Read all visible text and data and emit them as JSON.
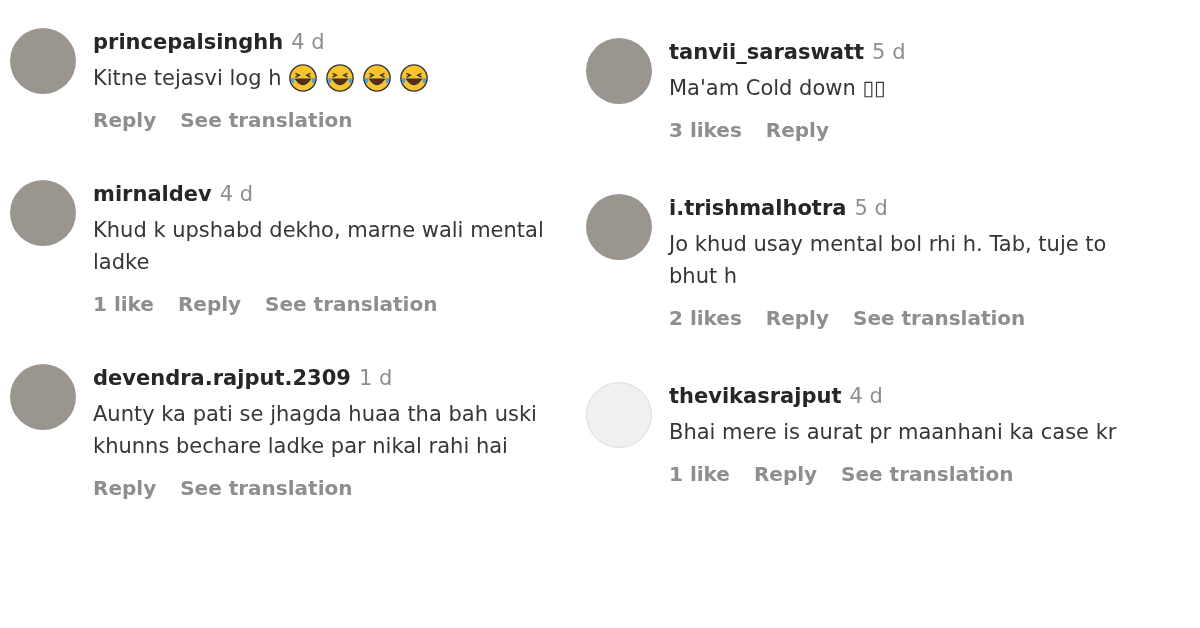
{
  "columns": [
    {
      "comments": [
        {
          "username": "princepalsinghh",
          "time": "4 d",
          "text": "Kitne tejasvi log h",
          "emojis": [
            {
              "kind": "laughing"
            },
            {
              "kind": "laughing"
            },
            {
              "kind": "laughing"
            },
            {
              "kind": "laughing"
            }
          ],
          "actions": [
            "Reply",
            "See translation"
          ]
        },
        {
          "username": "mirnaldev",
          "time": "4 d",
          "text": "Khud k upshabd dekho, marne wali mental ladke",
          "likes": "1 like",
          "actions": [
            "Reply",
            "See translation"
          ]
        },
        {
          "username": "devendra.rajput.2309",
          "time": "1 d",
          "text": "Aunty ka pati se jhagda huaa tha bah uski khunns bechare ladke par nikal rahi hai",
          "actions": [
            "Reply",
            "See translation"
          ]
        }
      ]
    },
    {
      "comments": [
        {
          "username": "tanvii_saraswatt",
          "time": "5 d",
          "text": "Ma'am Cold down ▯▯",
          "likes": "3 likes",
          "actions": [
            "Reply"
          ]
        },
        {
          "username": "i.trishmalhotra",
          "time": "5 d",
          "text": "Jo khud usay mental bol rhi h. Tab, tuje to bhut h",
          "likes": "2 likes",
          "actions": [
            "Reply",
            "See translation"
          ]
        },
        {
          "username": "thevikasrajput",
          "time": "4 d",
          "text": "Bhai mere is aurat pr maanhani ka case kr",
          "likes": "1 like",
          "actions": [
            "Reply",
            "See translation"
          ]
        }
      ]
    }
  ]
}
